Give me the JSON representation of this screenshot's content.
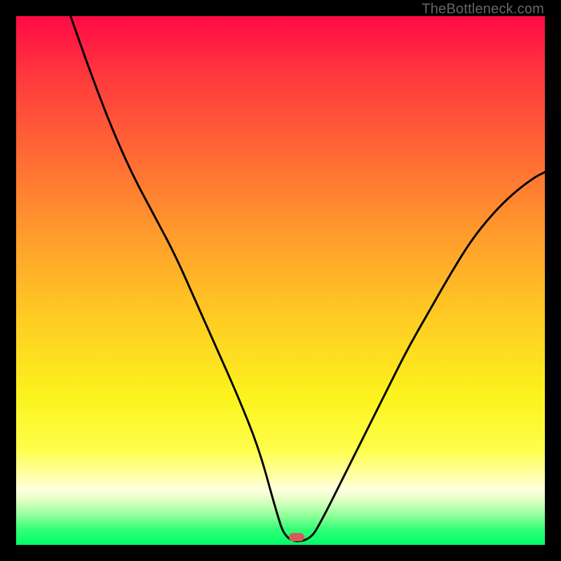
{
  "credit": "TheBottleneck.com",
  "marker": {
    "x_pct": 53,
    "y_pct": 98.6
  },
  "chart_data": {
    "type": "line",
    "title": "",
    "xlabel": "",
    "ylabel": "",
    "xlim": [
      0,
      100
    ],
    "ylim": [
      0,
      100
    ],
    "grid": false,
    "series": [
      {
        "name": "bottleneck-curve",
        "x": [
          10.3,
          14.0,
          18.0,
          22.0,
          26.0,
          30.0,
          34.0,
          38.0,
          42.0,
          46.0,
          49.0,
          51.0,
          55.5,
          58.0,
          62.0,
          66.0,
          70.0,
          74.0,
          78.0,
          82.0,
          86.0,
          90.0,
          94.0,
          98.0,
          100.0
        ],
        "y": [
          100,
          89.5,
          79.0,
          70.0,
          62.5,
          55.0,
          46.0,
          37.0,
          28.0,
          18.0,
          7.0,
          0.7,
          0.7,
          5.0,
          13.0,
          21.0,
          29.0,
          37.0,
          44.0,
          51.0,
          57.5,
          62.5,
          66.5,
          69.5,
          70.5
        ]
      }
    ],
    "annotations": [
      {
        "type": "marker",
        "shape": "pill",
        "color": "#d55b5b",
        "x": 53,
        "y": 1
      }
    ],
    "background_gradient": [
      {
        "pos": 0.0,
        "color": "#ff0a47"
      },
      {
        "pos": 0.12,
        "color": "#ff3b3d"
      },
      {
        "pos": 0.27,
        "color": "#ff6c34"
      },
      {
        "pos": 0.42,
        "color": "#ff9e2c"
      },
      {
        "pos": 0.57,
        "color": "#ffcb23"
      },
      {
        "pos": 0.72,
        "color": "#fcf31d"
      },
      {
        "pos": 0.82,
        "color": "#feff4b"
      },
      {
        "pos": 0.875,
        "color": "#ffffb4"
      },
      {
        "pos": 0.895,
        "color": "#ffffe0"
      },
      {
        "pos": 0.91,
        "color": "#e9ffcb"
      },
      {
        "pos": 0.925,
        "color": "#c8ffb6"
      },
      {
        "pos": 0.94,
        "color": "#9cffa0"
      },
      {
        "pos": 0.955,
        "color": "#6cff8c"
      },
      {
        "pos": 0.97,
        "color": "#34ff77"
      },
      {
        "pos": 1.0,
        "color": "#00ff66"
      }
    ]
  }
}
